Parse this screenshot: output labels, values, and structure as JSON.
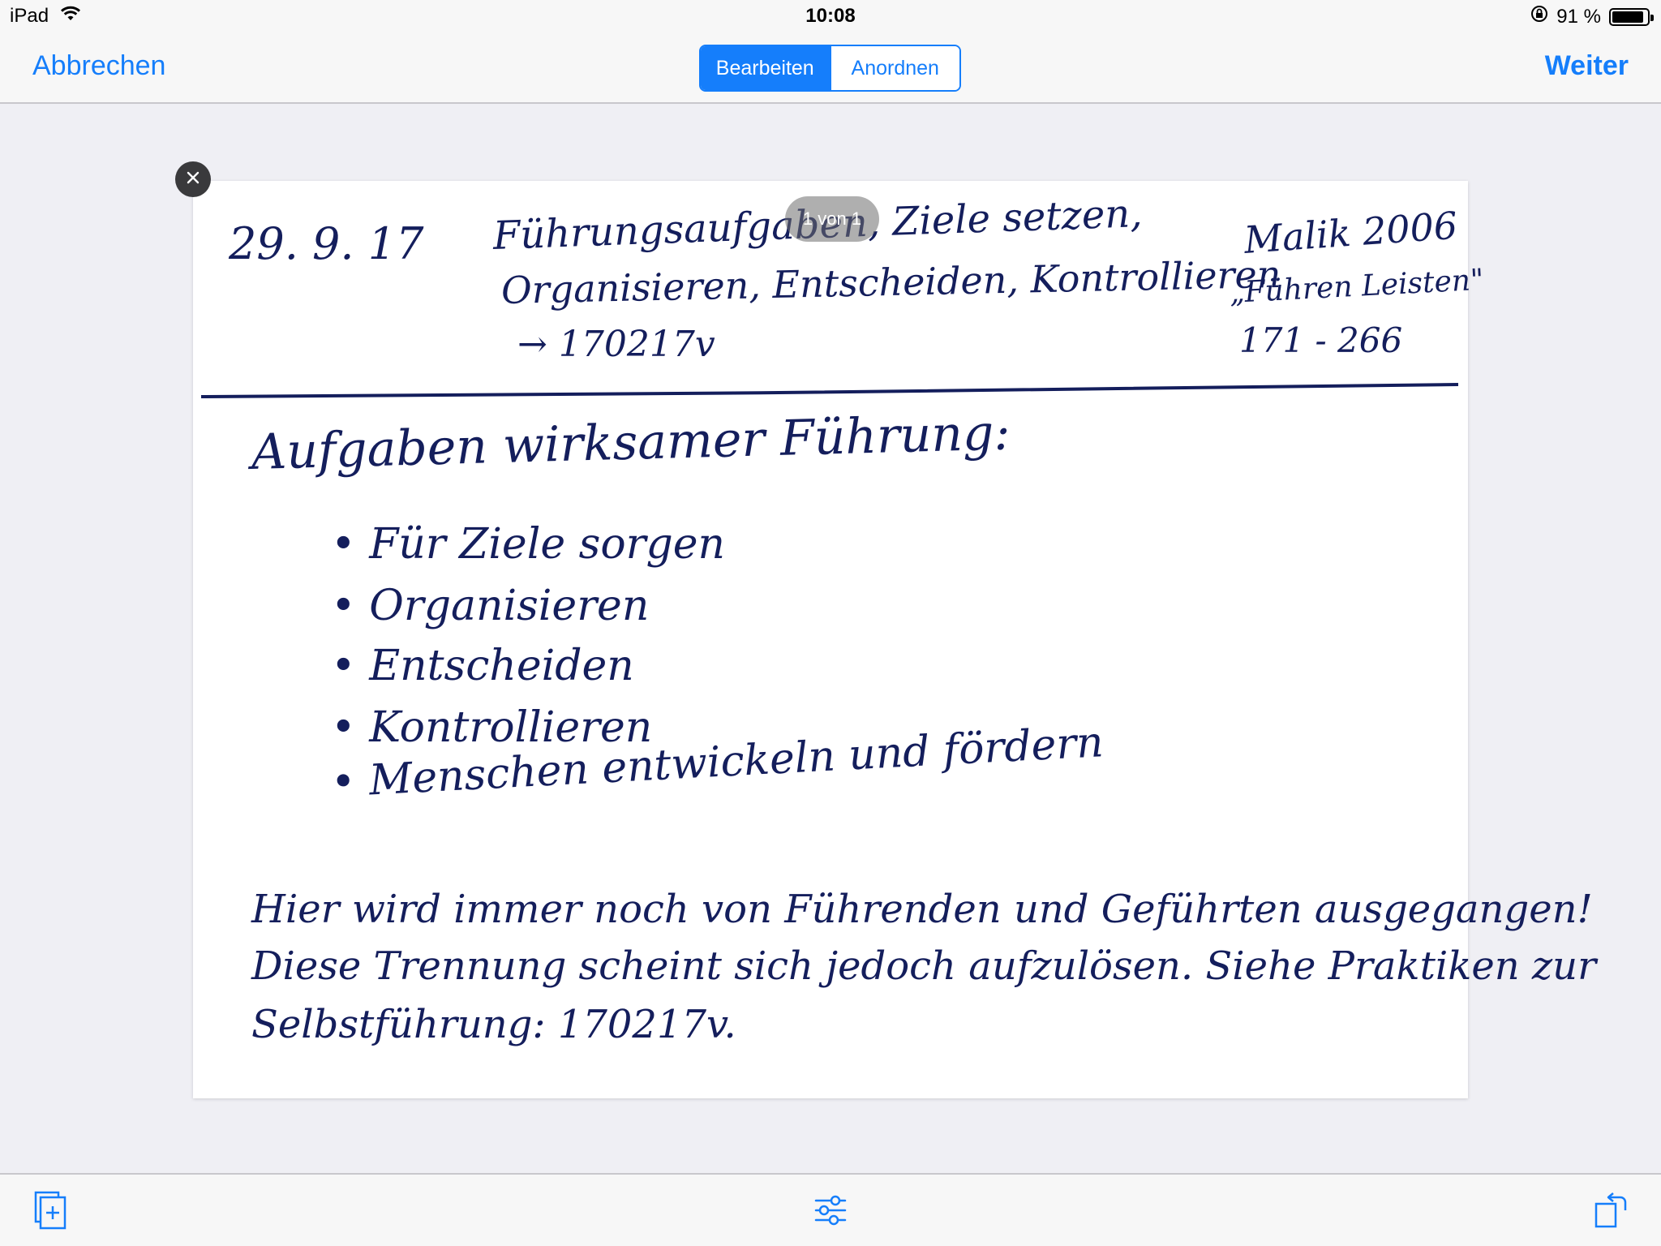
{
  "status_bar": {
    "device": "iPad",
    "time": "10:08",
    "battery_percent_label": "91 %",
    "battery_level": 0.91,
    "wifi_icon": "wifi-icon",
    "lock_icon": "orientation-lock-icon"
  },
  "nav": {
    "cancel_label": "Abbrechen",
    "next_label": "Weiter",
    "segments": [
      {
        "label": "Bearbeiten",
        "selected": true
      },
      {
        "label": "Anordnen",
        "selected": false
      }
    ]
  },
  "document": {
    "page_indicator": "1 von 1",
    "header": {
      "date": "29. 9. 17",
      "topic_line1": "Führungsaufgaben, Ziele setzen,",
      "topic_line2": "Organisieren, Entscheiden, Kontrollieren",
      "topic_ref": "→ 170217v",
      "source_line1": "Malik 2006",
      "source_line2": "„Führen Leisten\"",
      "source_line3": "171 - 266"
    },
    "heading": "Aufgaben wirksamer Führung:",
    "bullets": [
      "• Für Ziele sorgen",
      "• Organisieren",
      "• Entscheiden",
      "• Kontrollieren",
      "• Menschen entwickeln und fördern"
    ],
    "paragraph": [
      "Hier wird immer noch von Führenden und Geführten ausgegangen!",
      "Diese Trennung scheint sich jedoch aufzulösen. Siehe Praktiken zur",
      "Selbstführung: 170217v."
    ],
    "ink_color": "#141e5c"
  },
  "toolbar": {
    "add_page_icon": "add-page-icon",
    "filters_icon": "sliders-icon",
    "rotate_icon": "rotate-icon"
  },
  "colors": {
    "accent": "#157efb",
    "background": "#efeff4",
    "bar": "#f7f7f7"
  }
}
